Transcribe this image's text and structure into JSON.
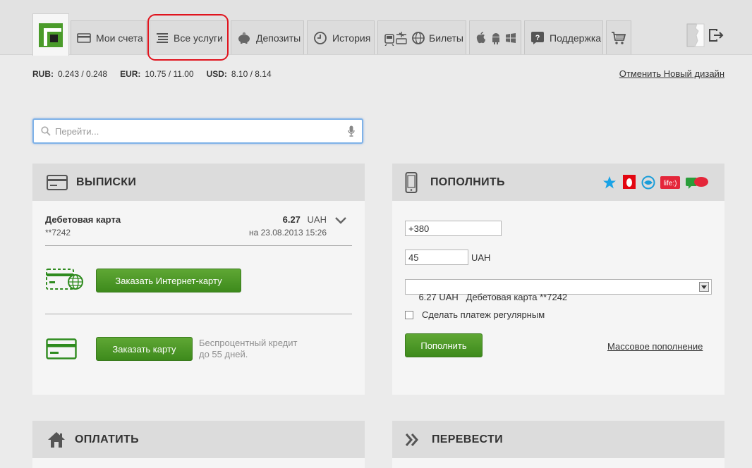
{
  "nav": {
    "tabs": [
      {
        "id": "accounts",
        "label": "Мои счета",
        "icon": "card-icon"
      },
      {
        "id": "services",
        "label": "Все услуги",
        "icon": "list-icon"
      },
      {
        "id": "deposits",
        "label": "Депозиты",
        "icon": "piggy-bank-icon"
      },
      {
        "id": "history",
        "label": "История",
        "icon": "clock-icon"
      },
      {
        "id": "tickets",
        "label": "Билеты",
        "icon": "transport-icon"
      },
      {
        "id": "mobile",
        "label": "",
        "icon": "mobile-os-icons"
      },
      {
        "id": "support",
        "label": "Поддержка",
        "icon": "question-icon"
      },
      {
        "id": "shop",
        "label": "",
        "icon": "cart-icon"
      }
    ]
  },
  "rates": [
    {
      "currency": "RUB:",
      "value": "0.243 / 0.248"
    },
    {
      "currency": "EUR:",
      "value": "10.75 / 11.00"
    },
    {
      "currency": "USD:",
      "value": "8.10 / 8.14"
    }
  ],
  "redesign_link": "Отменить Новый дизайн",
  "search": {
    "placeholder": "Перейти..."
  },
  "statements": {
    "title": "ВЫПИСКИ",
    "card": {
      "name": "Дебетовая карта",
      "number": "**7242",
      "amount": "6.27",
      "currency": "UAH",
      "date": "на 23.08.2013 15:26"
    },
    "order_internet_card": "Заказать Интернет-карту",
    "order_card": "Заказать карту",
    "credit_note_line1": "Беспроцентный кредит",
    "credit_note_line2": "до 55 дней."
  },
  "topup": {
    "title": "ПОПОЛНИТЬ",
    "phone_value": "+380",
    "amount_value": "45",
    "amount_currency": "UAH",
    "source_value": "6.27 UAH   Дебетовая карта **7242",
    "regular_label": "Сделать платеж регулярным",
    "submit": "Пополнить",
    "bulk_link": "Массовое пополнение",
    "operators": [
      "kyivstar",
      "mts",
      "djuice",
      "life:)",
      "utel"
    ]
  },
  "pay": {
    "title": "ОПЛАТИТЬ"
  },
  "transfer": {
    "title": "ПЕРЕВЕСТИ"
  },
  "colors": {
    "accent_green": "#4a9b2a",
    "highlight_red": "#e0141e",
    "search_border": "#7fb2e8"
  }
}
